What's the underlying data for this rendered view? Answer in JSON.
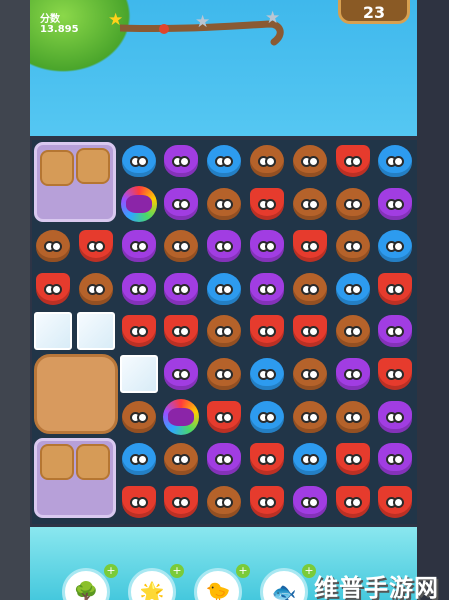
{
  "hud": {
    "score_label": "分数",
    "score_value": "13.895",
    "moves_left": "23",
    "progress_stars": [
      "gold",
      "silver",
      "silver"
    ]
  },
  "board": {
    "rows": [
      [
        "blocker",
        "blocker",
        "blue-blob",
        "purple-owl",
        "blue-blob",
        "brown-bear",
        "brown-bear",
        "red-fox",
        "blue-blob"
      ],
      [
        "blocker",
        "blocker",
        "rainbow",
        "purple-owl",
        "brown-bear",
        "red-fox",
        "brown-bear",
        "brown-bear",
        "purple-owl"
      ],
      [
        "brown-bear",
        "red-fox",
        "purple-owl",
        "brown-bear",
        "purple-owl",
        "purple-owl",
        "red-fox",
        "brown-bear",
        "blue-blob"
      ],
      [
        "red-fox",
        "brown-bear",
        "purple-owl",
        "purple-owl",
        "blue-blob",
        "purple-owl",
        "brown-bear",
        "blue-blob",
        "red-fox"
      ],
      [
        "ice",
        "ice",
        "red-fox",
        "red-fox",
        "brown-bear",
        "red-fox",
        "red-fox",
        "brown-bear",
        "purple-owl"
      ],
      [
        "blocker",
        "blocker",
        "ice",
        "purple-owl",
        "brown-bear",
        "blue-blob",
        "brown-bear",
        "purple-owl",
        "red-fox"
      ],
      [
        "blocker",
        "blocker",
        "brown-bear",
        "rainbow",
        "red-fox",
        "blue-blob",
        "brown-bear",
        "brown-bear",
        "purple-owl"
      ],
      [
        "blocker",
        "blocker",
        "blue-blob",
        "brown-bear",
        "purple-owl",
        "red-fox",
        "blue-blob",
        "red-fox",
        "purple-owl"
      ],
      [
        "blocker",
        "blocker",
        "red-fox",
        "red-fox",
        "brown-bear",
        "red-fox",
        "purple-owl",
        "red-fox",
        "red-fox"
      ]
    ]
  },
  "boosters": [
    {
      "name": "tree-booster",
      "icon": "🌳"
    },
    {
      "name": "sun-booster",
      "icon": "🌟"
    },
    {
      "name": "bird-booster",
      "icon": "🐤"
    },
    {
      "name": "fish-booster",
      "icon": "🐟"
    }
  ],
  "watermark": "维普手游网",
  "colors": {
    "purple-owl": "#a13de2",
    "blue-blob": "#2d9bef",
    "brown-bear": "#b5622a",
    "red-fox": "#e63b2d",
    "board_bg": "#213548"
  }
}
